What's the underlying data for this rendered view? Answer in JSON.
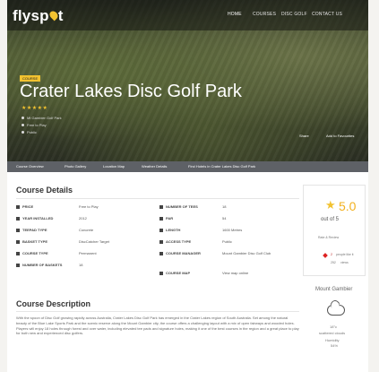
{
  "header": {
    "logo": {
      "pre": "flysp",
      "post": "t"
    },
    "nav": [
      "HOME",
      "COURSES",
      "DISC GOLF",
      "CONTACT US"
    ]
  },
  "hero": {
    "badge": "COURSE",
    "title": "Crater Lakes Disc Golf Park",
    "stars": "★★★★★",
    "meta": [
      "Mt Gambier Golf Park",
      "Free to Play",
      "Public"
    ],
    "share_label": "Share",
    "add_label": "Add to Favourites"
  },
  "tabs": [
    "Course Overview",
    "Photo Gallery",
    "Location Map",
    "Weather Details",
    "Find Hotels in Crater Lakes Disc Golf Park"
  ],
  "details": {
    "title": "Course Details",
    "left": [
      {
        "label": "PRICE",
        "value": "Free to Play"
      },
      {
        "label": "YEAR INSTALLED",
        "value": "2012"
      },
      {
        "label": "TEEPAD TYPE",
        "value": "Concrete"
      },
      {
        "label": "BASKET TYPE",
        "value": "DiscCatcher Target"
      },
      {
        "label": "COURSE TYPE",
        "value": "Permanent"
      },
      {
        "label": "NUMBER OF BASKETS",
        "value": "18"
      }
    ],
    "right": [
      {
        "label": "NUMBER OF TEES",
        "value": "18"
      },
      {
        "label": "PAR",
        "value": "54"
      },
      {
        "label": "LENGTH",
        "value": "1600 Metres"
      },
      {
        "label": "ACCESS TYPE",
        "value": "Public"
      },
      {
        "label": "COURSE MANAGER",
        "value": "Mount Gambier Disc Golf Club",
        "value2": ""
      },
      {
        "label": "COURSE MAP",
        "value": "View map online"
      }
    ]
  },
  "rating": {
    "score": "5.0",
    "out_of": "out of 5",
    "reviews": "Rate & Review",
    "likes": "2",
    "likes_label": "people like it",
    "views": "252",
    "views_label": "views"
  },
  "description": {
    "title": "Course Description",
    "text": "With the spoon of Disc Golf growing rapidly across Australia, Crater Lakes Disc Golf Park has emerged in the Crater Lakes region of South Australia. Set among the natural beauty of the Blue Lake Sports Park and the scenic reserve along the Mount Gambier city, the course offers a challenging layout with a mix of open fairways and wooded holes. Players will enjoy 18 holes through forest and over water, including elevated tee pads and signature holes, making it one of the best courses in the region and a great place to play for both new and experienced disc golfers."
  },
  "weather": {
    "city": "Mount Gambier",
    "temp": "18°c",
    "condition": "scattered clouds",
    "humidity_label": "Humidity",
    "humidity": "54%"
  }
}
